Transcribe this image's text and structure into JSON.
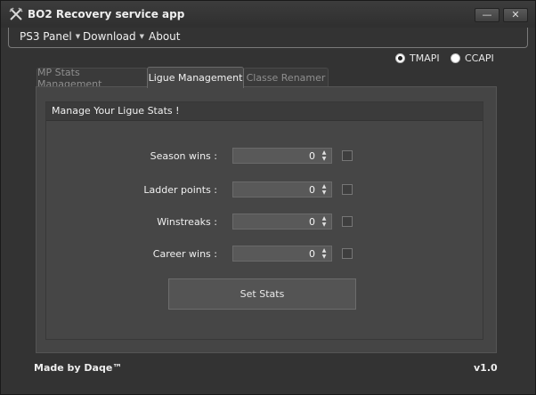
{
  "window": {
    "title": "BO2 Recovery service app",
    "minimize_label": "—",
    "close_label": "✕"
  },
  "menu": [
    {
      "label": "PS3 Panel",
      "has_dropdown": true
    },
    {
      "label": "Download",
      "has_dropdown": true
    },
    {
      "label": "About",
      "has_dropdown": false
    }
  ],
  "api": {
    "options": [
      {
        "label": "TMAPI",
        "checked": true
      },
      {
        "label": "CCAPI",
        "checked": false
      }
    ]
  },
  "tabs": [
    {
      "label": "MP Stats Management",
      "active": false
    },
    {
      "label": "Ligue Management",
      "active": true
    },
    {
      "label": "Classe Renamer",
      "active": false
    }
  ],
  "group": {
    "title": "Manage Your Ligue Stats !",
    "rows": [
      {
        "label": "Season wins :",
        "value": "0",
        "checked": false
      },
      {
        "label": "Ladder points :",
        "value": "0",
        "checked": false
      },
      {
        "label": "Winstreaks :",
        "value": "0",
        "checked": false
      },
      {
        "label": "Career wins :",
        "value": "0",
        "checked": false
      }
    ],
    "button_label": "Set Stats"
  },
  "footer": {
    "author": "Made by Daqe™",
    "version": "v1.0"
  },
  "icons": {
    "app": "crossed-swords-icon",
    "spin_up": "arrow-up-icon",
    "spin_down": "arrow-down-icon"
  }
}
